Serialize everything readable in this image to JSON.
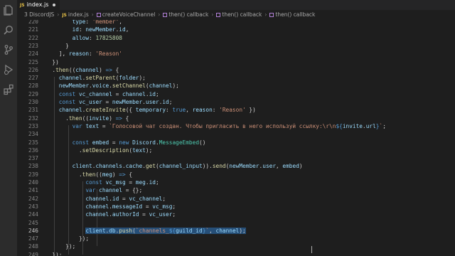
{
  "tab": {
    "lang": "JS",
    "filename": "index.js"
  },
  "breadcrumb": {
    "items": [
      "3 DiscordJS",
      "index.js",
      "createVoiceChannel",
      "then() callback",
      "then() callback",
      "then() callback"
    ],
    "file_lang": "JS"
  },
  "colors": {
    "accent": "#264f78",
    "keyword": "#569cd6",
    "string": "#ce9178",
    "function": "#dcdcaa",
    "variable": "#9cdcfe"
  },
  "icons": [
    "files-icon",
    "search-icon",
    "source-control-icon",
    "run-debug-icon",
    "extensions-icon"
  ],
  "active_line": "246",
  "lines": [
    {
      "n": "220",
      "tokens": [
        [
          "p",
          "        "
        ],
        [
          "v",
          "type"
        ],
        [
          "p",
          ": "
        ],
        [
          "s",
          "'member'"
        ],
        [
          "p",
          ","
        ]
      ]
    },
    {
      "n": "221",
      "tokens": [
        [
          "p",
          "        "
        ],
        [
          "v",
          "id"
        ],
        [
          "p",
          ": "
        ],
        [
          "v",
          "newMember"
        ],
        [
          "p",
          "."
        ],
        [
          "v",
          "id"
        ],
        [
          "p",
          ","
        ]
      ]
    },
    {
      "n": "222",
      "tokens": [
        [
          "p",
          "        "
        ],
        [
          "v",
          "allow"
        ],
        [
          "p",
          ": "
        ],
        [
          "n",
          "17825808"
        ]
      ]
    },
    {
      "n": "223",
      "tokens": [
        [
          "p",
          "      }"
        ]
      ]
    },
    {
      "n": "224",
      "tokens": [
        [
          "p",
          "    ], "
        ],
        [
          "v",
          "reason"
        ],
        [
          "p",
          ": "
        ],
        [
          "s",
          "'Reason'"
        ]
      ]
    },
    {
      "n": "225",
      "tokens": [
        [
          "p",
          "  })"
        ]
      ]
    },
    {
      "n": "226",
      "tokens": [
        [
          "p",
          "  ."
        ],
        [
          "f",
          "then"
        ],
        [
          "p",
          "(("
        ],
        [
          "v",
          "channel"
        ],
        [
          "p",
          ") "
        ],
        [
          "k",
          "=>"
        ],
        [
          "p",
          " {"
        ]
      ]
    },
    {
      "n": "227",
      "tokens": [
        [
          "p",
          "    "
        ],
        [
          "v",
          "channel"
        ],
        [
          "p",
          "."
        ],
        [
          "f",
          "setParent"
        ],
        [
          "p",
          "("
        ],
        [
          "v",
          "folder"
        ],
        [
          "p",
          ");"
        ]
      ]
    },
    {
      "n": "228",
      "tokens": [
        [
          "p",
          "    "
        ],
        [
          "v",
          "newMember"
        ],
        [
          "p",
          "."
        ],
        [
          "v",
          "voice"
        ],
        [
          "p",
          "."
        ],
        [
          "f",
          "setChannel"
        ],
        [
          "p",
          "("
        ],
        [
          "v",
          "channel"
        ],
        [
          "p",
          ");"
        ]
      ]
    },
    {
      "n": "229",
      "tokens": [
        [
          "p",
          "    "
        ],
        [
          "k",
          "const"
        ],
        [
          "p",
          " "
        ],
        [
          "v",
          "vc_channel"
        ],
        [
          "p",
          " = "
        ],
        [
          "v",
          "channel"
        ],
        [
          "p",
          "."
        ],
        [
          "v",
          "id"
        ],
        [
          "p",
          ";"
        ]
      ]
    },
    {
      "n": "230",
      "tokens": [
        [
          "p",
          "    "
        ],
        [
          "k",
          "const"
        ],
        [
          "p",
          " "
        ],
        [
          "v",
          "vc_user"
        ],
        [
          "p",
          " = "
        ],
        [
          "v",
          "newMember"
        ],
        [
          "p",
          "."
        ],
        [
          "v",
          "user"
        ],
        [
          "p",
          "."
        ],
        [
          "v",
          "id"
        ],
        [
          "p",
          ";"
        ]
      ]
    },
    {
      "n": "231",
      "tokens": [
        [
          "p",
          "    "
        ],
        [
          "v",
          "channel"
        ],
        [
          "p",
          "."
        ],
        [
          "f",
          "createInvite"
        ],
        [
          "p",
          "({ "
        ],
        [
          "v",
          "temporary"
        ],
        [
          "p",
          ": "
        ],
        [
          "k",
          "true"
        ],
        [
          "p",
          ", "
        ],
        [
          "v",
          "reason"
        ],
        [
          "p",
          ": "
        ],
        [
          "s",
          "'Reason'"
        ],
        [
          "p",
          " })"
        ]
      ]
    },
    {
      "n": "232",
      "tokens": [
        [
          "p",
          "      ."
        ],
        [
          "f",
          "then"
        ],
        [
          "p",
          "(("
        ],
        [
          "v",
          "invite"
        ],
        [
          "p",
          ") "
        ],
        [
          "k",
          "=>"
        ],
        [
          "p",
          " {"
        ]
      ]
    },
    {
      "n": "233",
      "tokens": [
        [
          "p",
          "        "
        ],
        [
          "k",
          "var"
        ],
        [
          "p",
          " "
        ],
        [
          "v",
          "text"
        ],
        [
          "p",
          " = "
        ],
        [
          "s",
          "`Голосовой чат создан. Чтобы пригласить в него используй ссылку:\\r\\n"
        ],
        [
          "k",
          "${"
        ],
        [
          "v",
          "invite"
        ],
        [
          "p",
          "."
        ],
        [
          "v",
          "url"
        ],
        [
          "k",
          "}"
        ],
        [
          "s",
          "`"
        ],
        [
          "p",
          ";"
        ]
      ]
    },
    {
      "n": "234",
      "tokens": []
    },
    {
      "n": "235",
      "tokens": [
        [
          "p",
          "        "
        ],
        [
          "k",
          "const"
        ],
        [
          "p",
          " "
        ],
        [
          "v",
          "embed"
        ],
        [
          "p",
          " = "
        ],
        [
          "k",
          "new"
        ],
        [
          "p",
          " "
        ],
        [
          "v",
          "Discord"
        ],
        [
          "p",
          "."
        ],
        [
          "c",
          "MessageEmbed"
        ],
        [
          "p",
          "()"
        ]
      ]
    },
    {
      "n": "236",
      "tokens": [
        [
          "p",
          "          ."
        ],
        [
          "f",
          "setDescription"
        ],
        [
          "p",
          "("
        ],
        [
          "v",
          "text"
        ],
        [
          "p",
          ");"
        ]
      ]
    },
    {
      "n": "237",
      "tokens": []
    },
    {
      "n": "238",
      "tokens": [
        [
          "p",
          "        "
        ],
        [
          "v",
          "client"
        ],
        [
          "p",
          "."
        ],
        [
          "v",
          "channels"
        ],
        [
          "p",
          "."
        ],
        [
          "v",
          "cache"
        ],
        [
          "p",
          "."
        ],
        [
          "f",
          "get"
        ],
        [
          "p",
          "("
        ],
        [
          "v",
          "channel_input"
        ],
        [
          "p",
          "))."
        ],
        [
          "f",
          "send"
        ],
        [
          "p",
          "("
        ],
        [
          "v",
          "newMember"
        ],
        [
          "p",
          "."
        ],
        [
          "v",
          "user"
        ],
        [
          "p",
          ", "
        ],
        [
          "v",
          "embed"
        ],
        [
          "p",
          ")"
        ]
      ]
    },
    {
      "n": "239",
      "tokens": [
        [
          "p",
          "          ."
        ],
        [
          "f",
          "then"
        ],
        [
          "p",
          "(("
        ],
        [
          "v",
          "meg"
        ],
        [
          "p",
          ") "
        ],
        [
          "k",
          "=>"
        ],
        [
          "p",
          " {"
        ]
      ]
    },
    {
      "n": "240",
      "tokens": [
        [
          "p",
          "            "
        ],
        [
          "k",
          "const"
        ],
        [
          "p",
          " "
        ],
        [
          "v",
          "vc_msg"
        ],
        [
          "p",
          " = "
        ],
        [
          "v",
          "meg"
        ],
        [
          "p",
          "."
        ],
        [
          "v",
          "id"
        ],
        [
          "p",
          ";"
        ]
      ]
    },
    {
      "n": "241",
      "tokens": [
        [
          "p",
          "            "
        ],
        [
          "k",
          "var"
        ],
        [
          "p",
          " "
        ],
        [
          "v",
          "channel"
        ],
        [
          "p",
          " = {};"
        ]
      ]
    },
    {
      "n": "242",
      "tokens": [
        [
          "p",
          "            "
        ],
        [
          "v",
          "channel"
        ],
        [
          "p",
          "."
        ],
        [
          "v",
          "id"
        ],
        [
          "p",
          " = "
        ],
        [
          "v",
          "vc_channel"
        ],
        [
          "p",
          ";"
        ]
      ]
    },
    {
      "n": "243",
      "tokens": [
        [
          "p",
          "            "
        ],
        [
          "v",
          "channel"
        ],
        [
          "p",
          "."
        ],
        [
          "v",
          "messageId"
        ],
        [
          "p",
          " = "
        ],
        [
          "v",
          "vc_msg"
        ],
        [
          "p",
          ";"
        ]
      ]
    },
    {
      "n": "244",
      "tokens": [
        [
          "p",
          "            "
        ],
        [
          "v",
          "channel"
        ],
        [
          "p",
          "."
        ],
        [
          "v",
          "authorId"
        ],
        [
          "p",
          " = "
        ],
        [
          "v",
          "vc_user"
        ],
        [
          "p",
          ";"
        ]
      ]
    },
    {
      "n": "245",
      "tokens": []
    },
    {
      "n": "246",
      "indent": "            ",
      "selected": true,
      "tokens": [
        [
          "v",
          "client"
        ],
        [
          "p",
          "."
        ],
        [
          "v",
          "db"
        ],
        [
          "p",
          "."
        ],
        [
          "f",
          "push"
        ],
        [
          "p",
          "("
        ],
        [
          "s",
          "`channels_"
        ],
        [
          "k",
          "${"
        ],
        [
          "v",
          "guild_id"
        ],
        [
          "k",
          "}"
        ],
        [
          "s",
          "`"
        ],
        [
          "p",
          ", "
        ],
        [
          "v",
          "channel"
        ],
        [
          "p",
          ");"
        ]
      ]
    },
    {
      "n": "247",
      "tokens": [
        [
          "p",
          "          });"
        ]
      ]
    },
    {
      "n": "248",
      "tokens": [
        [
          "p",
          "      });"
        ]
      ]
    },
    {
      "n": "249",
      "tokens": [
        [
          "p",
          "  });"
        ]
      ]
    }
  ]
}
